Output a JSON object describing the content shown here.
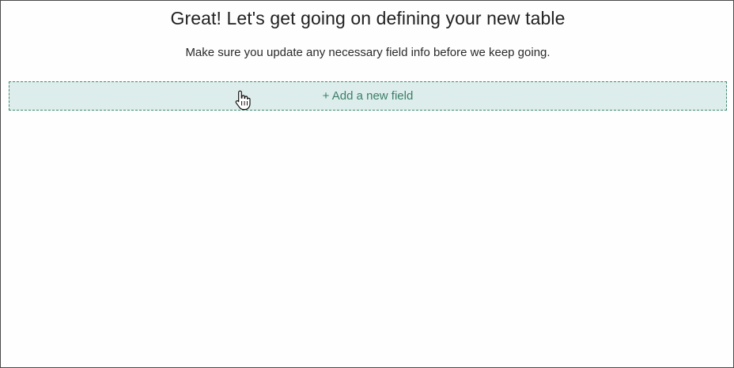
{
  "header": {
    "title": "Great! Let's get going on defining your new table",
    "subtitle": "Make sure you update any necessary field info before we keep going."
  },
  "main": {
    "add_field_label": "+ Add a new field"
  },
  "colors": {
    "accent_text": "#3d7d68",
    "accent_fill": "#dcedeb",
    "accent_border": "#3f8a6e"
  },
  "icons": {
    "cursor": "hand-pointer-icon"
  }
}
